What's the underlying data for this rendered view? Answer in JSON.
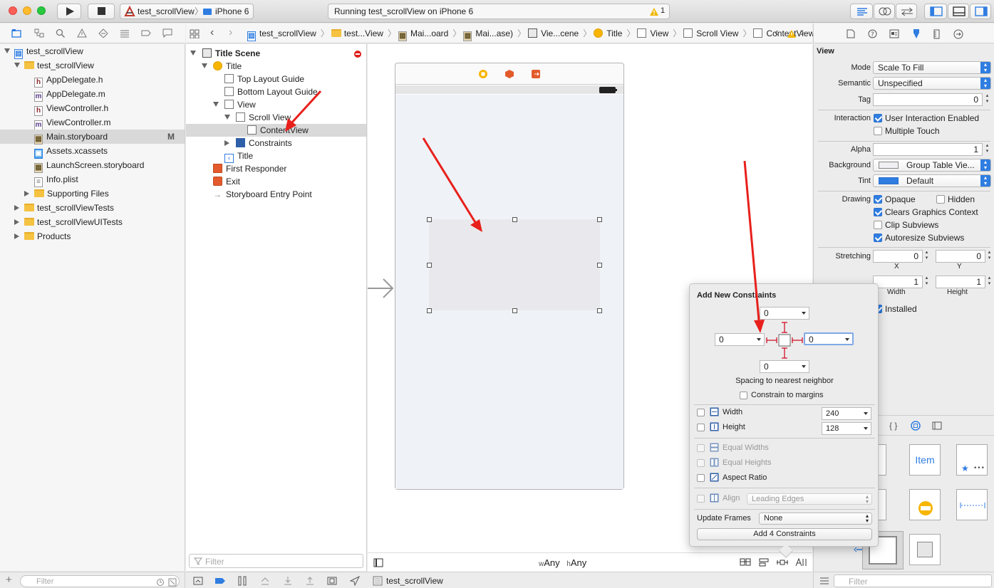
{
  "toolbar": {
    "scheme": "test_scrollView",
    "device": "iPhone 6",
    "status": "Running test_scrollView on iPhone 6",
    "warnings": "1"
  },
  "breadcrumb": [
    "test_scrollView",
    "test...View",
    "Mai...oard",
    "Mai...ase)",
    "Vie...cene",
    "Title",
    "View",
    "Scroll View",
    "ContentView"
  ],
  "navigator": {
    "items": [
      {
        "label": "test_scrollView",
        "type": "project",
        "indent": 0,
        "disclosure": "open"
      },
      {
        "label": "test_scrollView",
        "type": "folder",
        "indent": 1,
        "disclosure": "open"
      },
      {
        "label": "AppDelegate.h",
        "type": "h",
        "indent": 2
      },
      {
        "label": "AppDelegate.m",
        "type": "m",
        "indent": 2
      },
      {
        "label": "ViewController.h",
        "type": "h",
        "indent": 2
      },
      {
        "label": "ViewController.m",
        "type": "m",
        "indent": 2
      },
      {
        "label": "Main.storyboard",
        "type": "storyboard",
        "indent": 2,
        "badge": "M",
        "selected": true
      },
      {
        "label": "Assets.xcassets",
        "type": "assets",
        "indent": 2
      },
      {
        "label": "LaunchScreen.storyboard",
        "type": "storyboard",
        "indent": 2
      },
      {
        "label": "Info.plist",
        "type": "plist",
        "indent": 2
      },
      {
        "label": "Supporting Files",
        "type": "folder",
        "indent": 2,
        "disclosure": "closed"
      },
      {
        "label": "test_scrollViewTests",
        "type": "folder",
        "indent": 1,
        "disclosure": "closed"
      },
      {
        "label": "test_scrollViewUITests",
        "type": "folder",
        "indent": 1,
        "disclosure": "closed"
      },
      {
        "label": "Products",
        "type": "folder",
        "indent": 1,
        "disclosure": "closed"
      }
    ],
    "filter_placeholder": "Filter"
  },
  "outline": {
    "items": [
      {
        "label": "Title Scene",
        "indent": 0,
        "bold": true,
        "disclosure": "open"
      },
      {
        "label": "Title",
        "indent": 1,
        "icon": "vc",
        "disclosure": "open"
      },
      {
        "label": "Top Layout Guide",
        "indent": 2,
        "icon": "box"
      },
      {
        "label": "Bottom Layout Guide",
        "indent": 2,
        "icon": "box"
      },
      {
        "label": "View",
        "indent": 2,
        "icon": "box",
        "disclosure": "open"
      },
      {
        "label": "Scroll View",
        "indent": 3,
        "icon": "box",
        "disclosure": "open"
      },
      {
        "label": "ContentView",
        "indent": 4,
        "icon": "box",
        "selected": true
      },
      {
        "label": "Constraints",
        "indent": 3,
        "icon": "cons",
        "disclosure": "closed"
      },
      {
        "label": "Title",
        "indent": 2,
        "icon": "nav"
      },
      {
        "label": "First Responder",
        "indent": 1,
        "icon": "cube"
      },
      {
        "label": "Exit",
        "indent": 1,
        "icon": "exit"
      },
      {
        "label": "Storyboard Entry Point",
        "indent": 1,
        "icon": "arrow"
      }
    ],
    "filter_placeholder": "Filter"
  },
  "canvas": {
    "size_w": "Any",
    "size_h": "Any",
    "w_prefix": "w",
    "h_prefix": "h"
  },
  "constraints_popover": {
    "title": "Add New Constraints",
    "top": "0",
    "left": "0",
    "right": "0",
    "bottom": "0",
    "spacing_label": "Spacing to nearest neighbor",
    "constrain_margins": "Constrain to margins",
    "width_label": "Width",
    "width_value": "240",
    "height_label": "Height",
    "height_value": "128",
    "equal_widths": "Equal Widths",
    "equal_heights": "Equal Heights",
    "aspect_ratio": "Aspect Ratio",
    "align_label": "Align",
    "align_value": "Leading Edges",
    "update_frames_label": "Update Frames",
    "update_frames_value": "None",
    "add_button": "Add 4 Constraints"
  },
  "inspector": {
    "section": "View",
    "mode_label": "Mode",
    "mode_value": "Scale To Fill",
    "semantic_label": "Semantic",
    "semantic_value": "Unspecified",
    "tag_label": "Tag",
    "tag_value": "0",
    "interaction_label": "Interaction",
    "user_interaction": "User Interaction Enabled",
    "multiple_touch": "Multiple Touch",
    "alpha_label": "Alpha",
    "alpha_value": "1",
    "background_label": "Background",
    "background_value": "Group Table Vie...",
    "tint_label": "Tint",
    "tint_value": "Default",
    "drawing_label": "Drawing",
    "opaque": "Opaque",
    "hidden": "Hidden",
    "clears": "Clears Graphics Context",
    "clip": "Clip Subviews",
    "autoresize": "Autoresize Subviews",
    "stretching_label": "Stretching",
    "stretch_x": "0",
    "stretch_y": "0",
    "x_label": "X",
    "y_label": "Y",
    "stretch_w": "1",
    "stretch_h": "1",
    "width_label": "Width",
    "height_label": "Height",
    "installed": "Installed",
    "library_item": "Item",
    "filter_placeholder": "Filter"
  },
  "bottom": {
    "target": "test_scrollView"
  },
  "colors": {
    "accent": "#2f7de1",
    "selection": "#d9d9d9",
    "arrow": "#e8201c"
  }
}
